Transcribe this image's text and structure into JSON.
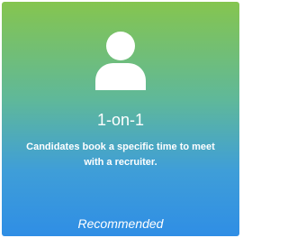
{
  "card": {
    "icon": "user-icon",
    "title": "1-on-1",
    "description": "Candidates book a specific time to meet with a recruiter.",
    "badge": "Recommended",
    "colors": {
      "gradient_top": "#85c54f",
      "gradient_bottom": "#2f8ee5",
      "text": "#ffffff"
    }
  }
}
